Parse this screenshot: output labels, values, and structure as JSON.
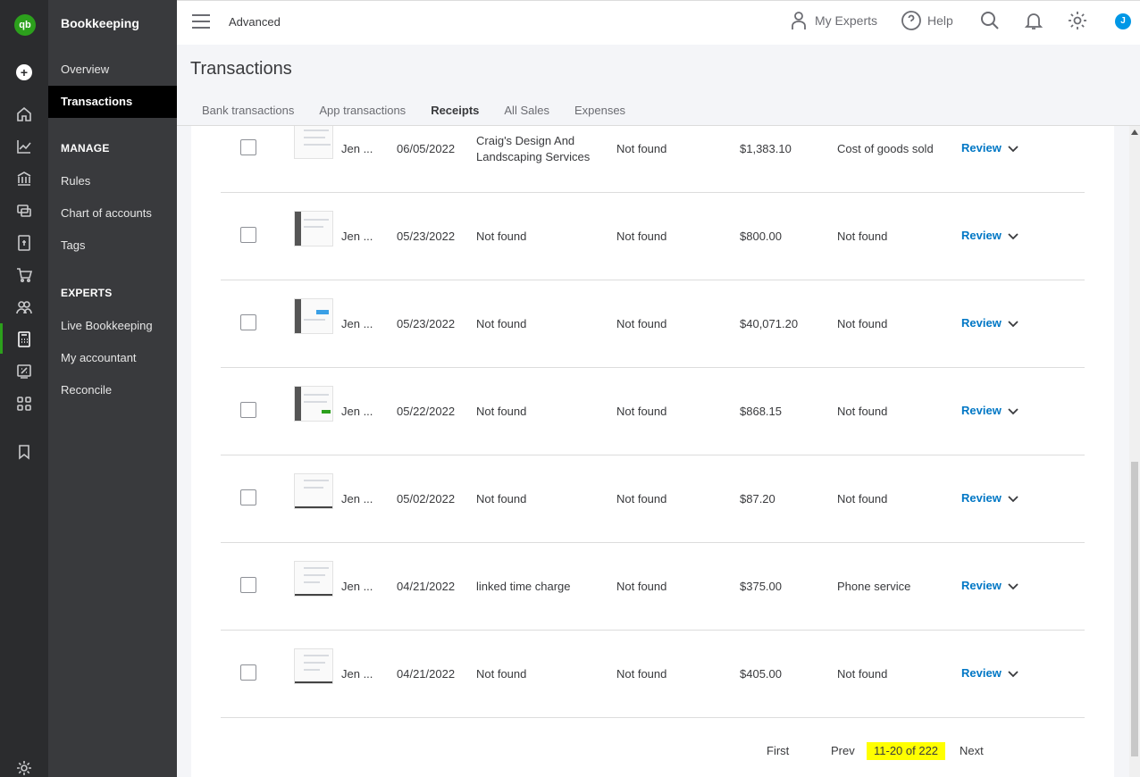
{
  "app": {
    "logo": "qb",
    "section_title": "Bookkeeping",
    "brand_color": "#2ca01c",
    "accent_color": "#0077c5"
  },
  "rail": {
    "icons": [
      "home-icon",
      "chart-icon",
      "bank-icon",
      "expenses-icon",
      "sales-icon",
      "cart-icon",
      "people-icon",
      "calculator-icon",
      "tax-icon",
      "apps-icon",
      "bookmark-icon",
      "settings-icon"
    ]
  },
  "nav": {
    "items": [
      "Overview",
      "Transactions"
    ],
    "manage_header": "MANAGE",
    "manage_items": [
      "Rules",
      "Chart of accounts",
      "Tags"
    ],
    "experts_header": "EXPERTS",
    "experts_items": [
      "Live Bookkeeping",
      "My accountant",
      "Reconcile"
    ]
  },
  "topbar": {
    "mode": "Advanced",
    "my_experts": "My Experts",
    "help": "Help",
    "avatar": "J"
  },
  "page": {
    "title": "Transactions",
    "tabs": [
      "Bank transactions",
      "App transactions",
      "Receipts",
      "All Sales",
      "Expenses"
    ],
    "active_tab": "Receipts"
  },
  "rows": [
    {
      "from": "Jen ...",
      "date": "06/05/2022",
      "payee": "Craig's Design And Landscaping Services",
      "match": "Not found",
      "amount": "$1,383.10",
      "category": "Cost of goods sold",
      "action": "Review"
    },
    {
      "from": "Jen ...",
      "date": "05/23/2022",
      "payee": "Not found",
      "match": "Not found",
      "amount": "$800.00",
      "category": "Not found",
      "action": "Review"
    },
    {
      "from": "Jen ...",
      "date": "05/23/2022",
      "payee": "Not found",
      "match": "Not found",
      "amount": "$40,071.20",
      "category": "Not found",
      "action": "Review"
    },
    {
      "from": "Jen ...",
      "date": "05/22/2022",
      "payee": "Not found",
      "match": "Not found",
      "amount": "$868.15",
      "category": "Not found",
      "action": "Review"
    },
    {
      "from": "Jen ...",
      "date": "05/02/2022",
      "payee": "Not found",
      "match": "Not found",
      "amount": "$87.20",
      "category": "Not found",
      "action": "Review"
    },
    {
      "from": "Jen ...",
      "date": "04/21/2022",
      "payee": "linked time charge",
      "match": "Not found",
      "amount": "$375.00",
      "category": "Phone service",
      "action": "Review"
    },
    {
      "from": "Jen ...",
      "date": "04/21/2022",
      "payee": "Not found",
      "match": "Not found",
      "amount": "$405.00",
      "category": "Not found",
      "action": "Review"
    }
  ],
  "pager": {
    "first": "First",
    "prev": "Prev",
    "range": "11-20 of 222",
    "next": "Next"
  }
}
